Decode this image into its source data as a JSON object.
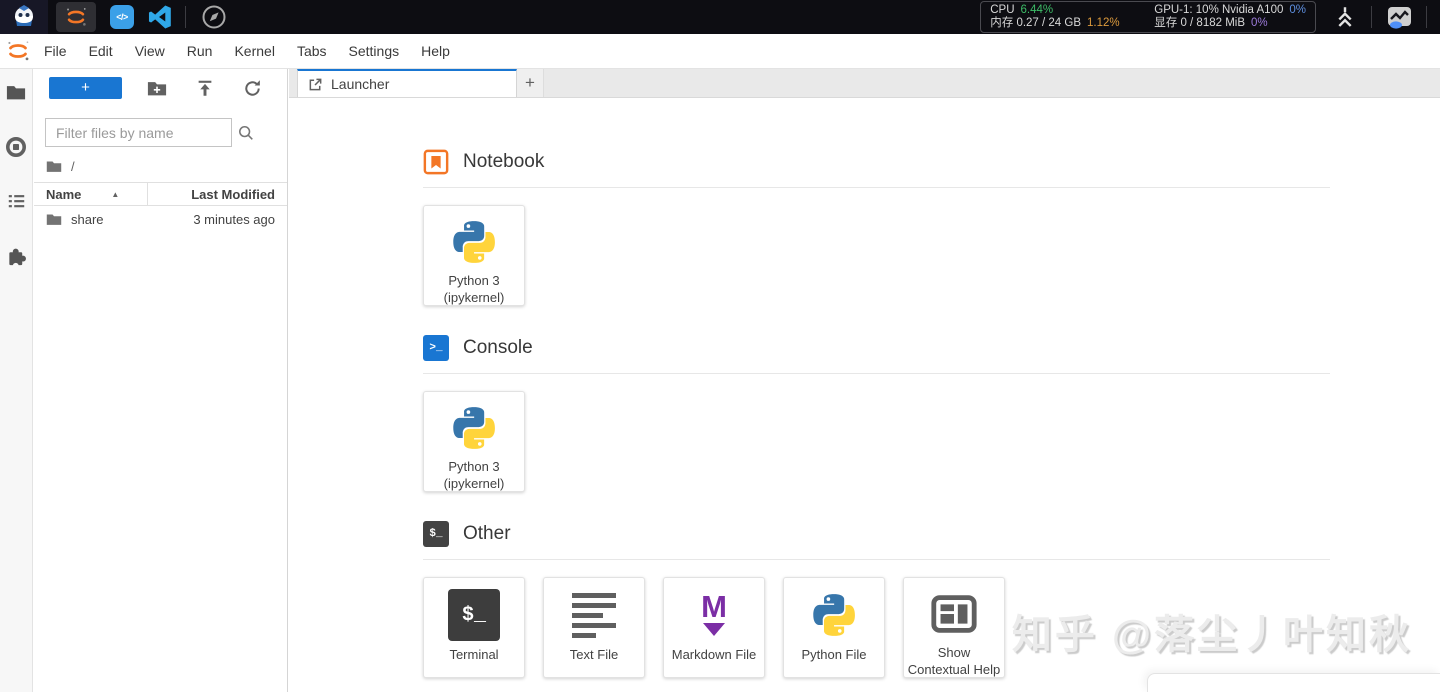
{
  "topbar": {
    "code_glyph": "</>",
    "stats": {
      "cpu_label": "CPU",
      "cpu_value": "6.44%",
      "gpu_label": "GPU-1: 10% Nvidia A100",
      "gpu_value": "0%",
      "mem_label": "内存 0.27 / 24 GB",
      "mem_value": "1.12%",
      "vram_label": "显存 0 / 8182 MiB",
      "vram_value": "0%"
    }
  },
  "menubar": {
    "items": [
      "File",
      "Edit",
      "View",
      "Run",
      "Kernel",
      "Tabs",
      "Settings",
      "Help"
    ]
  },
  "filebrowser": {
    "toolbar": {
      "new_glyph": "+"
    },
    "filter_placeholder": "Filter files by name",
    "breadcrumb_root": "/",
    "header_name": "Name",
    "sort_asc_glyph": "▲",
    "header_modified": "Last Modified",
    "rows": [
      {
        "name": "share",
        "modified": "3 minutes ago"
      }
    ]
  },
  "tabbar": {
    "active_tab": "Launcher",
    "add_glyph": "+"
  },
  "launcher": {
    "console_glyph": ">_",
    "other_glyph": "$_",
    "terminal_glyph": "$_",
    "markdown_letter": "M",
    "sections": [
      {
        "title": "Notebook",
        "cards": [
          {
            "line1": "Python 3",
            "line2": "(ipykernel)"
          }
        ]
      },
      {
        "title": "Console",
        "cards": [
          {
            "line1": "Python 3",
            "line2": "(ipykernel)"
          }
        ]
      },
      {
        "title": "Other",
        "cards": [
          {
            "line1": "Terminal",
            "line2": ""
          },
          {
            "line1": "Text File",
            "line2": ""
          },
          {
            "line1": "Markdown File",
            "line2": ""
          },
          {
            "line1": "Python File",
            "line2": ""
          },
          {
            "line1": "Show",
            "line2": "Contextual Help"
          }
        ]
      }
    ]
  },
  "watermark": "知乎 @落尘丿叶知秋",
  "colors": {
    "accent": "#1976d2",
    "notebook_orange": "#f37626",
    "markdown_purple": "#7b2ea5",
    "stat_green": "#3dbd67",
    "stat_orange": "#dd9b3d",
    "stat_blue": "#5e8fe0",
    "stat_purple": "#9d7bdb"
  }
}
